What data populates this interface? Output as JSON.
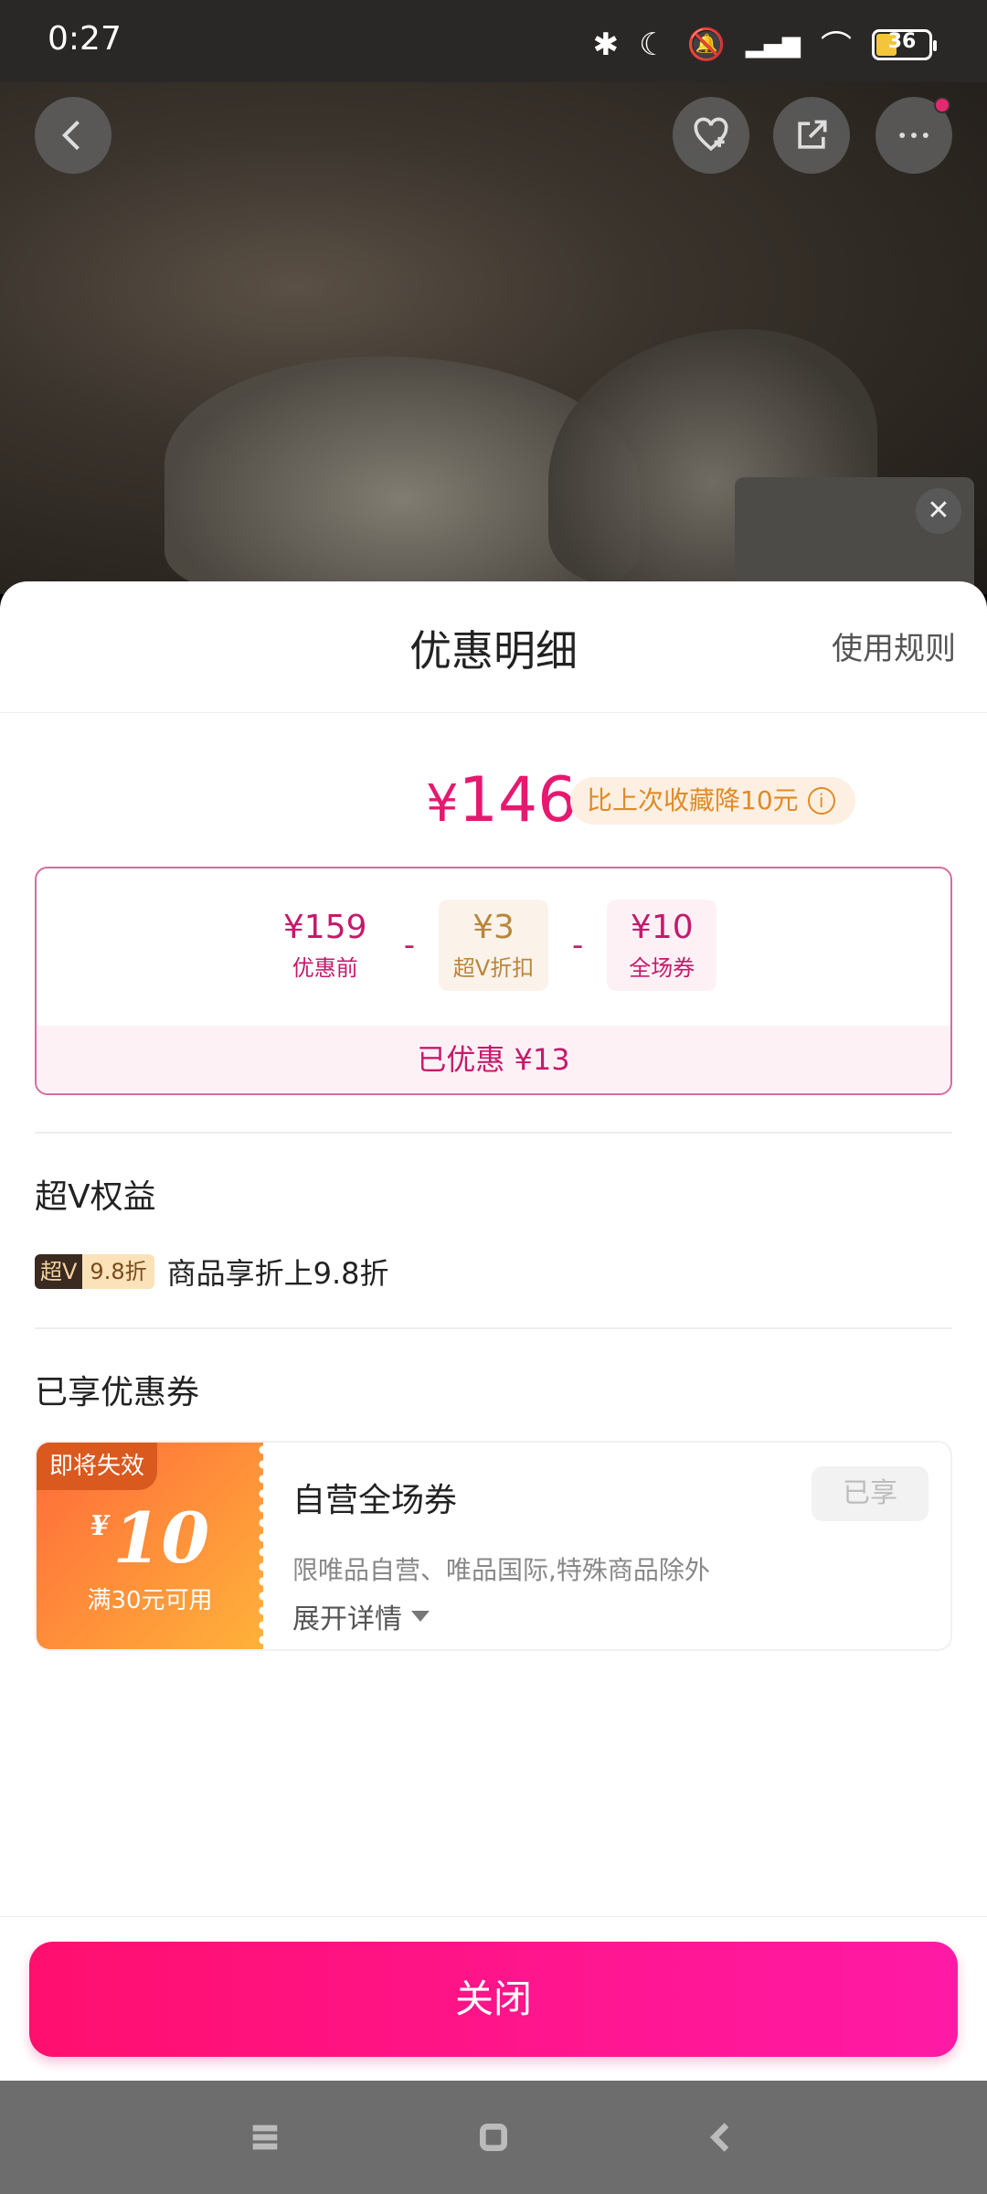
{
  "status": {
    "time": "0:27",
    "battery": "36"
  },
  "sheet": {
    "title": "优惠明细",
    "rules_link": "使用规则",
    "price": {
      "currency": "¥",
      "amount": "146"
    },
    "drop_note": "比上次收藏降10元",
    "breakdown": [
      {
        "value": "¥159",
        "label": "优惠前"
      },
      {
        "value": "¥3",
        "label": "超V折扣"
      },
      {
        "value": "¥10",
        "label": "全场券"
      }
    ],
    "minus": "-",
    "saved": "已优惠 ¥13",
    "vip_section": {
      "title": "超V权益",
      "tag_a": "超V",
      "tag_b": "9.8折",
      "text": "商品享折上9.8折"
    },
    "coupon_section": {
      "title": "已享优惠券",
      "expiring": "即将失效",
      "currency": "¥",
      "amount": "10",
      "condition": "满30元可用",
      "name": "自营全场券",
      "desc": "限唯品自营、唯品国际,特殊商品除外",
      "expand": "展开详情",
      "status_button": "已享"
    },
    "close_button": "关闭"
  }
}
